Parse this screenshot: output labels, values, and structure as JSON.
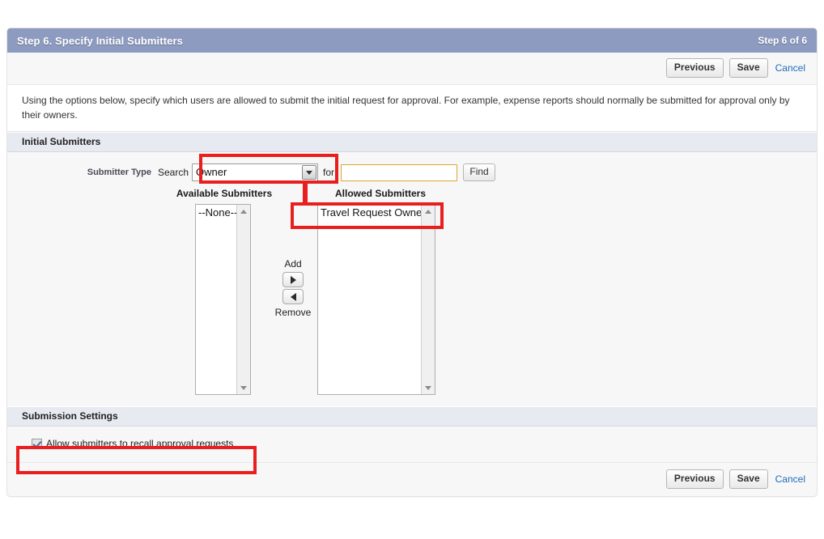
{
  "header": {
    "title": "Step 6. Specify Initial Submitters",
    "step_count": "Step 6 of 6"
  },
  "toolbar_top": {
    "previous_label": "Previous",
    "save_label": "Save",
    "cancel_label": "Cancel"
  },
  "toolbar_bottom": {
    "previous_label": "Previous",
    "save_label": "Save",
    "cancel_label": "Cancel"
  },
  "description": "Using the options below, specify which users are allowed to submit the initial request for approval. For example, expense reports should normally be submitted for approval only by their owners.",
  "initial_submitters": {
    "section_title": "Initial Submitters",
    "submitter_type_label": "Submitter Type",
    "search_label": "Search",
    "search_type_selected": "Owner",
    "for_label": "for:",
    "for_value": "",
    "for_placeholder": "",
    "find_label": "Find",
    "available_label": "Available Submitters",
    "allowed_label": "Allowed Submitters",
    "available_options": [
      "--None--"
    ],
    "allowed_options": [
      "Travel Request Owner"
    ],
    "add_label": "Add",
    "remove_label": "Remove"
  },
  "submission_settings": {
    "section_title": "Submission Settings",
    "recall_label": "Allow submitters to recall approval requests",
    "recall_checked": true
  },
  "annotation": {
    "color": "#e81f1f",
    "boxes": [
      "search-type-dropdown",
      "allowed-submitters-first-option",
      "recall-checkbox"
    ],
    "arrow": "dropdown-to-allowed-submitters"
  }
}
